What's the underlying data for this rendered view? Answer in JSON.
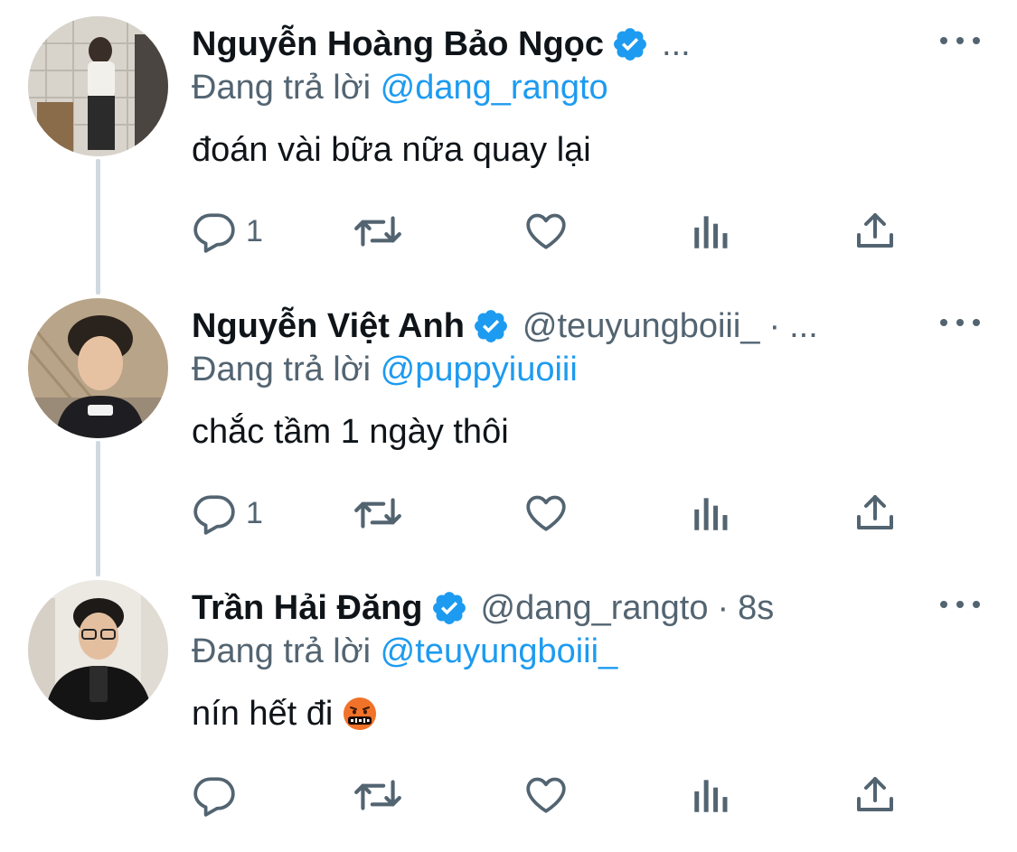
{
  "tweets": [
    {
      "name": "Nguyễn Hoàng Bảo Ngọc",
      "handle": "",
      "dot": "",
      "time": "",
      "ellipsis": "...",
      "replying_prefix": "Đang trả lời",
      "replying_to": "@dang_rangto",
      "text": "đoán vài bữa nữa quay lại",
      "reply_count": "1"
    },
    {
      "name": "Nguyễn Việt Anh",
      "handle": "@teuyungboiii_",
      "dot": "·",
      "time": "",
      "ellipsis": "...",
      "replying_prefix": "Đang trả lời",
      "replying_to": "@puppyiuoiii",
      "text": "chắc tầm 1 ngày thôi",
      "reply_count": "1"
    },
    {
      "name": "Trần Hải Đăng",
      "handle": "@dang_rangto",
      "dot": "·",
      "time": "8s",
      "ellipsis": "",
      "replying_prefix": "Đang trả lời",
      "replying_to": "@teuyungboiii_",
      "text": "nín hết đi",
      "reply_count": ""
    }
  ],
  "icons": {
    "verified": "verified-badge-icon",
    "reply": "reply-icon",
    "retweet": "retweet-icon",
    "like": "heart-icon",
    "views": "views-chart-icon",
    "share": "share-icon",
    "more": "more-options-icon",
    "emoji": "face-with-symbols-on-mouth-emoji"
  },
  "colors": {
    "text": "#0f1419",
    "secondary": "#536471",
    "accent": "#1d9bf0",
    "thread_line": "#cfd9de"
  }
}
